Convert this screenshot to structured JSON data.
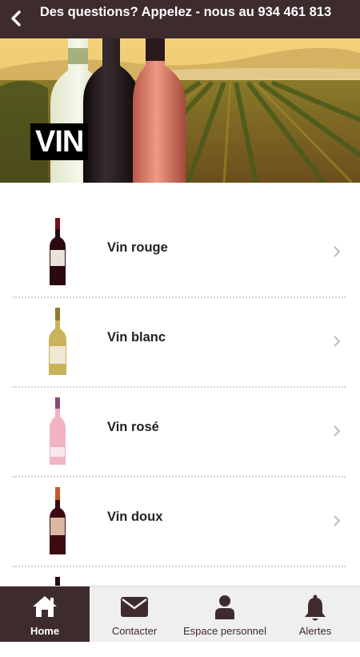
{
  "header": {
    "title": "Des questions? Appelez - nous au 934 461 813"
  },
  "hero": {
    "label": "VIN"
  },
  "list": {
    "items": [
      {
        "label": "Vin rouge",
        "bottle_color": "#4a1016",
        "label_color": "#e9e3da"
      },
      {
        "label": "Vin blanc",
        "bottle_color": "#c9b25a",
        "label_color": "#efe8d2"
      },
      {
        "label": "Vin rosé",
        "bottle_color": "#f1b4c0",
        "label_color": "#f6e9ee"
      },
      {
        "label": "Vin doux",
        "bottle_color": "#3b0a12",
        "label_color": "#d9b8a2"
      }
    ]
  },
  "tabbar": {
    "tabs": [
      {
        "label": "Home",
        "icon": "home-icon"
      },
      {
        "label": "Contacter",
        "icon": "envelope-icon"
      },
      {
        "label": "Espace personnel",
        "icon": "user-icon"
      },
      {
        "label": "Alertes",
        "icon": "bell-icon"
      }
    ]
  },
  "colors": {
    "brand": "#3e2b2d",
    "tabbar_bg": "#f0efef"
  }
}
